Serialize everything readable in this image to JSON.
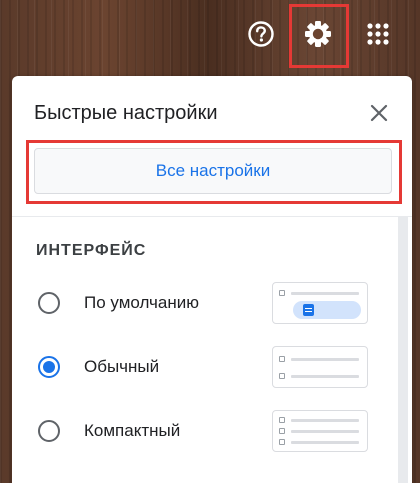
{
  "topbar": {
    "help_icon": "help-circle-icon",
    "settings_icon": "gear-icon",
    "apps_icon": "apps-grid-icon"
  },
  "panel": {
    "title": "Быстрые настройки",
    "close_icon": "close-icon",
    "all_settings_label": "Все настройки"
  },
  "density": {
    "heading": "ИНТЕРФЕЙС",
    "options": [
      {
        "label": "По умолчанию",
        "checked": false
      },
      {
        "label": "Обычный",
        "checked": true
      },
      {
        "label": "Компактный",
        "checked": false
      }
    ]
  },
  "colors": {
    "accent": "#1a73e8",
    "highlight": "#e53935"
  }
}
